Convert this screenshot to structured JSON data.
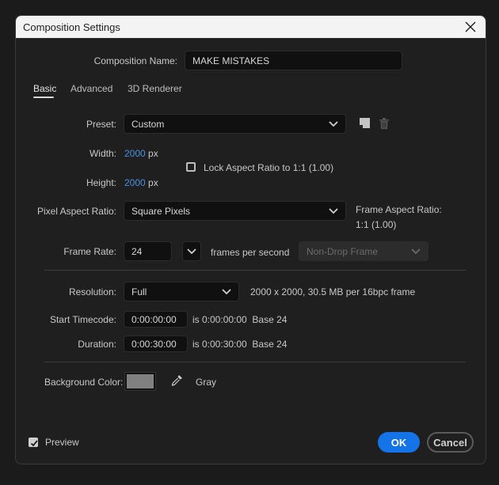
{
  "dialog": {
    "title": "Composition Settings",
    "close_icon": "close-x-icon"
  },
  "composition_name": {
    "label": "Composition Name:",
    "value": "MAKE MISTAKES"
  },
  "tabs": [
    {
      "label": "Basic",
      "active": true
    },
    {
      "label": "Advanced",
      "active": false
    },
    {
      "label": "3D Renderer",
      "active": false
    }
  ],
  "preset": {
    "label": "Preset:",
    "value": "Custom",
    "save_icon": "save-preset-icon",
    "delete_icon": "trash-icon"
  },
  "width": {
    "label": "Width:",
    "value": "2000",
    "unit": "px"
  },
  "height": {
    "label": "Height:",
    "value": "2000",
    "unit": "px"
  },
  "lock_aspect": {
    "label": "Lock Aspect Ratio to 1:1 (1.00)",
    "checked": false
  },
  "pixel_aspect": {
    "label": "Pixel Aspect Ratio:",
    "value": "Square Pixels",
    "frame_aspect_label": "Frame Aspect Ratio:",
    "frame_aspect_value": "1:1 (1.00)"
  },
  "frame_rate": {
    "label": "Frame Rate:",
    "value": "24",
    "unit": "frames per second",
    "drop_frame": "Non-Drop Frame"
  },
  "resolution": {
    "label": "Resolution:",
    "value": "Full",
    "info": "2000 x 2000, 30.5 MB per 16bpc frame"
  },
  "start_timecode": {
    "label": "Start Timecode:",
    "value": "0:00:00:00",
    "info": "is 0:00:00:00  Base 24"
  },
  "duration": {
    "label": "Duration:",
    "value": "0:00:30:00",
    "info": "is 0:00:30:00  Base 24"
  },
  "background_color": {
    "label": "Background Color:",
    "color": "#808080",
    "name": "Gray",
    "eyedropper_icon": "eyedropper-icon"
  },
  "preview": {
    "label": "Preview",
    "checked": true
  },
  "buttons": {
    "ok": "OK",
    "cancel": "Cancel"
  },
  "colors": {
    "accent": "#1473e6",
    "link_value": "#4a90e2"
  }
}
